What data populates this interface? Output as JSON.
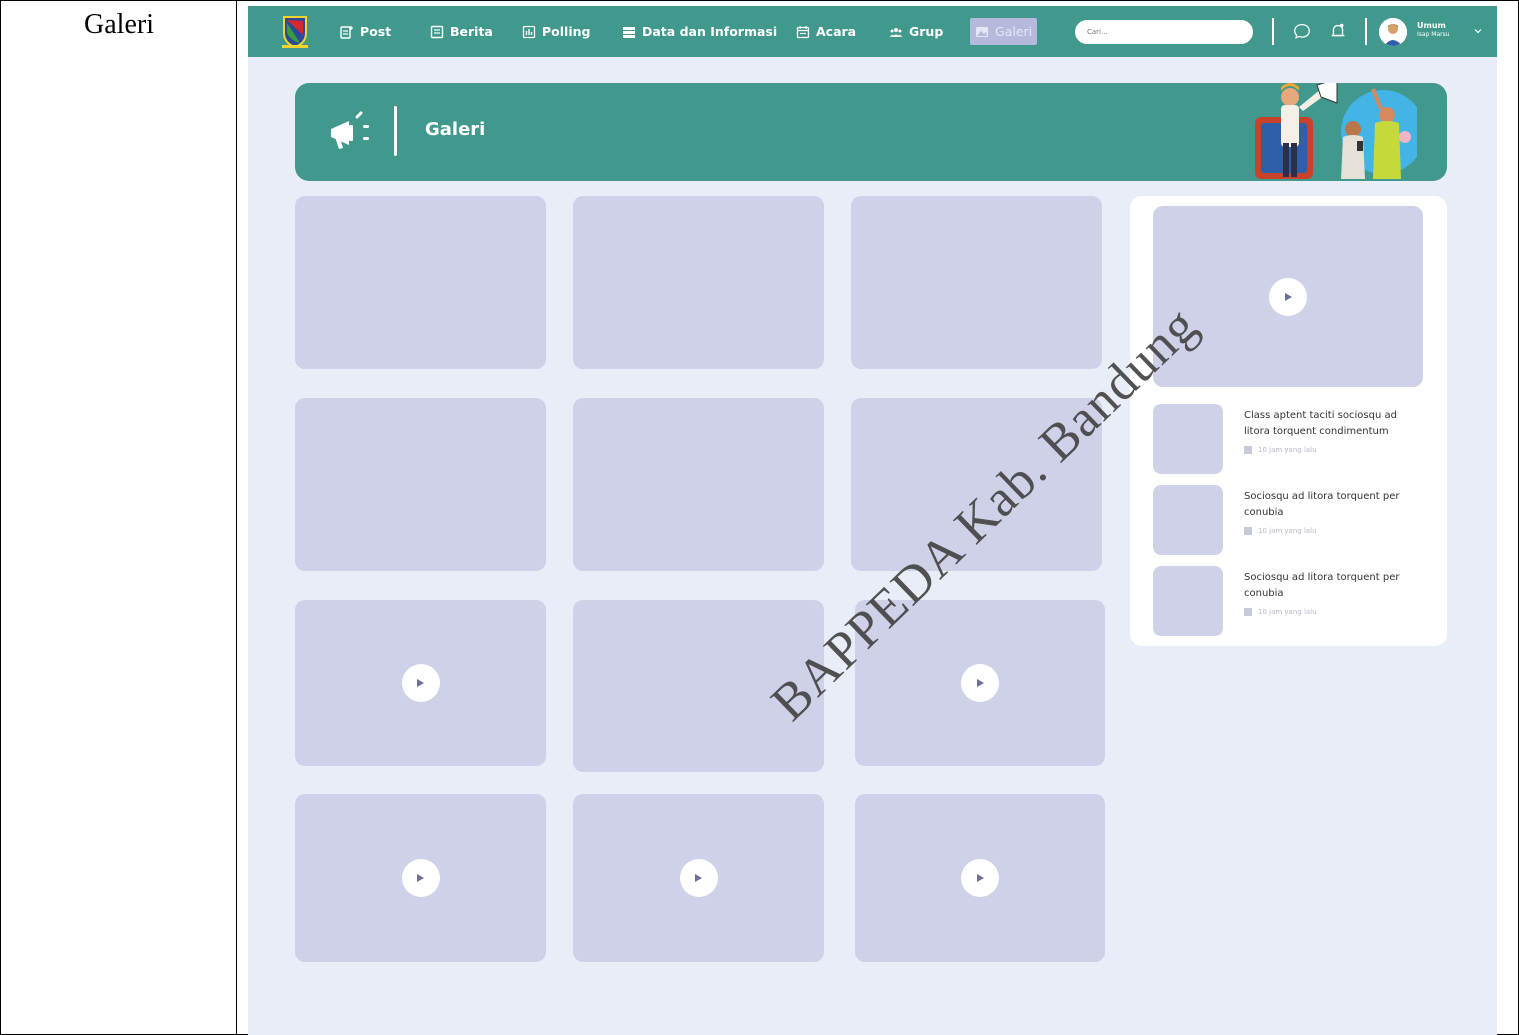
{
  "doc": {
    "row_label": "Galeri",
    "watermark": "BAPPEDA Kab. Bandung"
  },
  "nav": {
    "items": [
      {
        "label": "Post",
        "icon": "post-icon"
      },
      {
        "label": "Berita",
        "icon": "news-icon"
      },
      {
        "label": "Polling",
        "icon": "poll-icon"
      },
      {
        "label": "Data dan Informasi",
        "icon": "data-icon"
      },
      {
        "label": "Acara",
        "icon": "calendar-icon"
      },
      {
        "label": "Grup",
        "icon": "group-icon"
      },
      {
        "label": "Galeri",
        "icon": "image-icon",
        "active": true
      }
    ],
    "search_placeholder": "Cari...",
    "user_name": "Umum",
    "user_role": "Isap Marsu",
    "colors": {
      "primary": "#40998c",
      "active": "#b6b9dc",
      "tile": "#cfd1e8",
      "page": "#e9edf7"
    }
  },
  "banner": {
    "title": "Galeri"
  },
  "side": {
    "items": [
      {
        "title": "Class aptent taciti sociosqu ad litora torquent condimentum",
        "time": "10 jam yang lalu"
      },
      {
        "title": "Sociosqu ad litora torquent per conubia",
        "time": "10 jam yang lalu"
      },
      {
        "title": "Sociosqu ad litora torquent per conubia",
        "time": "10 jam yang lalu"
      }
    ]
  }
}
